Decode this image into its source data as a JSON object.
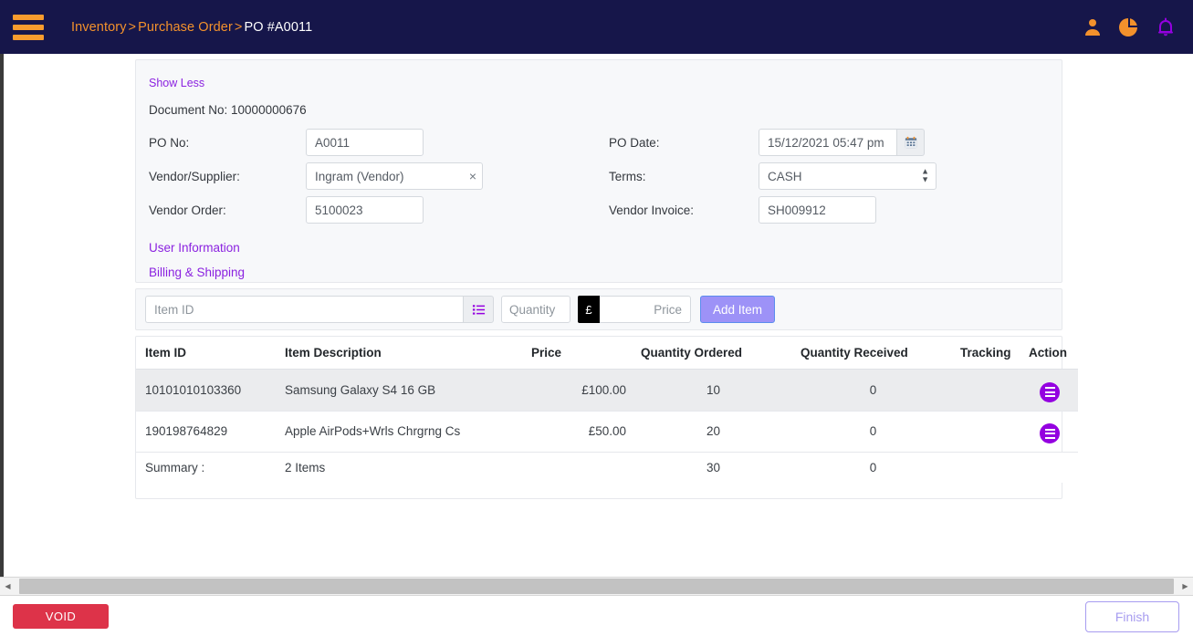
{
  "topbar": {
    "menu_icon": "hamburger-icon",
    "breadcrumb": {
      "level1": "Inventory",
      "separator1": ">",
      "level2": "Purchase Order",
      "separator2": ">",
      "current": "PO #A0011"
    },
    "icons": [
      {
        "name": "user-icon",
        "color": "#f3912c"
      },
      {
        "name": "pie-chart-icon",
        "color": "#f3912c"
      },
      {
        "name": "bell-icon",
        "color": "#9400e0"
      }
    ]
  },
  "form": {
    "show_less_label": "Show Less",
    "document_no_label": "Document No: 10000000676",
    "po_no_label": "PO No:",
    "po_no_value": "A0011",
    "vendor_label": "Vendor/Supplier:",
    "vendor_value": "Ingram (Vendor)",
    "vendor_clear_icon": "×",
    "vendor_order_label": "Vendor Order:",
    "vendor_order_value": "5100023",
    "po_date_label": "PO Date:",
    "po_date_value": "15/12/2021 05:47 pm",
    "terms_label": "Terms:",
    "terms_value": "CASH",
    "vendor_invoice_label": "Vendor Invoice:",
    "vendor_invoice_value": "SH009912",
    "user_information_label": "User Information",
    "billing_shipping_label": "Billing & Shipping"
  },
  "add_item_bar": {
    "item_id_placeholder": "Item ID",
    "item_id_value": "",
    "list_icon": "list-icon",
    "quantity_placeholder": "Quantity",
    "quantity_value": "",
    "currency_symbol": "£",
    "price_placeholder": "Price",
    "price_value": "",
    "add_item_label": "Add Item",
    "add_item_color": "#9d92f7"
  },
  "items_table": {
    "headers": {
      "item_id": "Item ID",
      "item_description": "Item Description",
      "price": "Price",
      "quantity_ordered": "Quantity Ordered",
      "quantity_received": "Quantity Received",
      "tracking": "Tracking",
      "action": "Action"
    },
    "rows": [
      {
        "item_id": "10101010103360",
        "description": "Samsung Galaxy S4 16 GB",
        "price": "£100.00",
        "quantity_ordered": "10",
        "quantity_received": "0",
        "tracking": "",
        "action_icon": "menu-action-icon"
      },
      {
        "item_id": "190198764829",
        "description": "Apple AirPods+Wrls Chrgrng Cs",
        "price": "£50.00",
        "quantity_ordered": "20",
        "quantity_received": "0",
        "tracking": "",
        "action_icon": "menu-action-icon"
      }
    ],
    "summary": {
      "label": "Summary :",
      "description": "2 Items",
      "price": "",
      "quantity_ordered": "30",
      "quantity_received": "0",
      "tracking": "",
      "action": ""
    }
  },
  "footer": {
    "void_label": "VOID",
    "void_color": "#dd3349",
    "finish_label": "Finish",
    "finish_color": "#a79cf0"
  },
  "scrollbar": {
    "left_arrow": "◀",
    "right_arrow": "▶"
  }
}
